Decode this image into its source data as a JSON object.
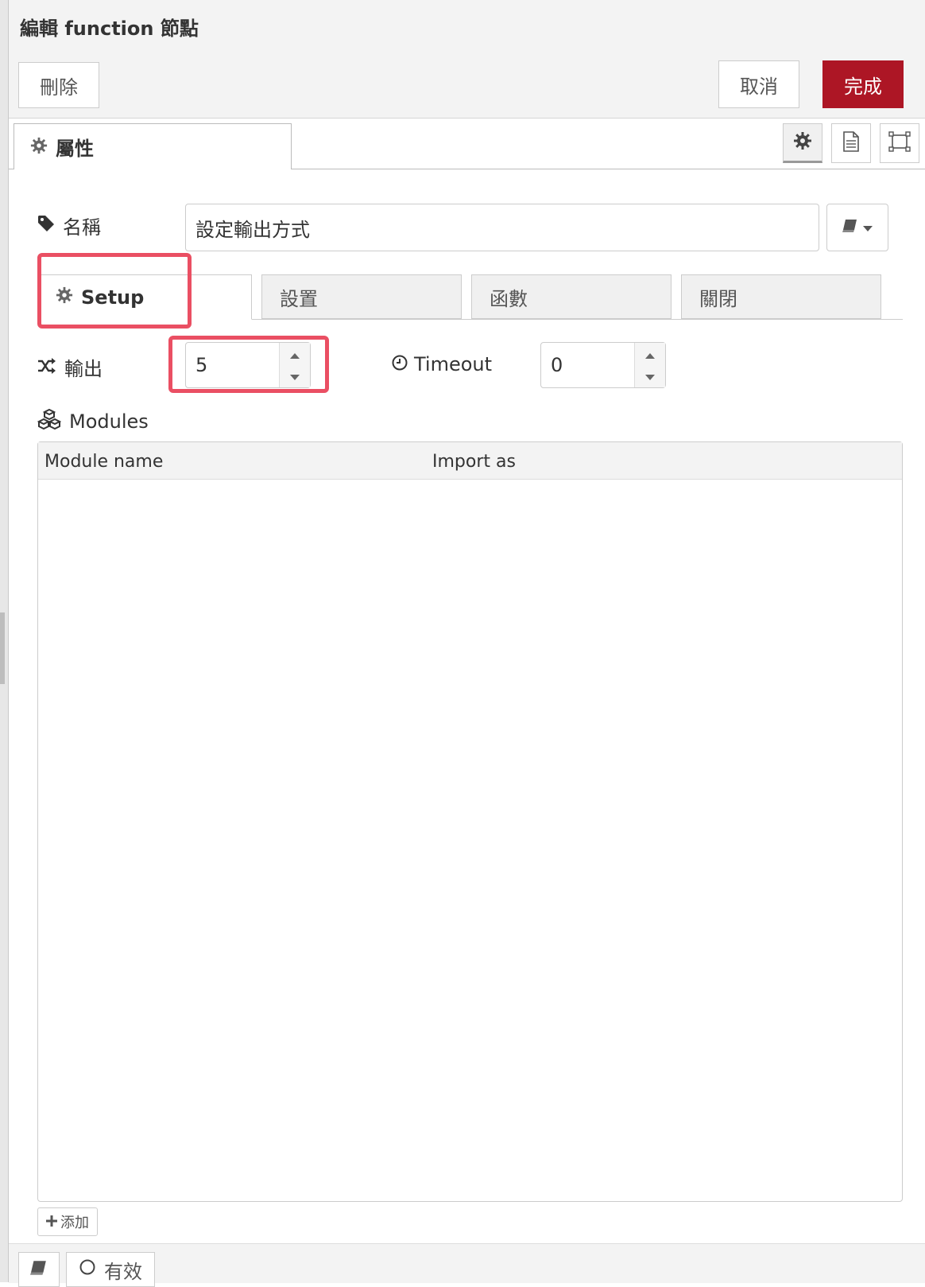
{
  "dialog": {
    "title": "編輯 function 節點"
  },
  "toolbar": {
    "delete_label": "刪除",
    "cancel_label": "取消",
    "done_label": "完成"
  },
  "tabs": {
    "properties_label": "屬性",
    "icons": [
      "gear-icon",
      "document-icon",
      "frame-icon"
    ]
  },
  "form": {
    "name_label": "名稱",
    "name_value": "設定輸出方式",
    "subtabs": [
      {
        "label": "Setup",
        "active": true
      },
      {
        "label": "設置",
        "active": false
      },
      {
        "label": "函數",
        "active": false
      },
      {
        "label": "關閉",
        "active": false
      }
    ],
    "outputs_label": "輸出",
    "outputs_value": "5",
    "timeout_label": "Timeout",
    "timeout_value": "0",
    "modules_label": "Modules",
    "modules_columns": [
      "Module name",
      "Import as"
    ],
    "add_label": "添加"
  },
  "footer": {
    "enabled_label": "有效"
  },
  "colors": {
    "primary": "#ad1625",
    "highlight": "#ea4f63"
  }
}
